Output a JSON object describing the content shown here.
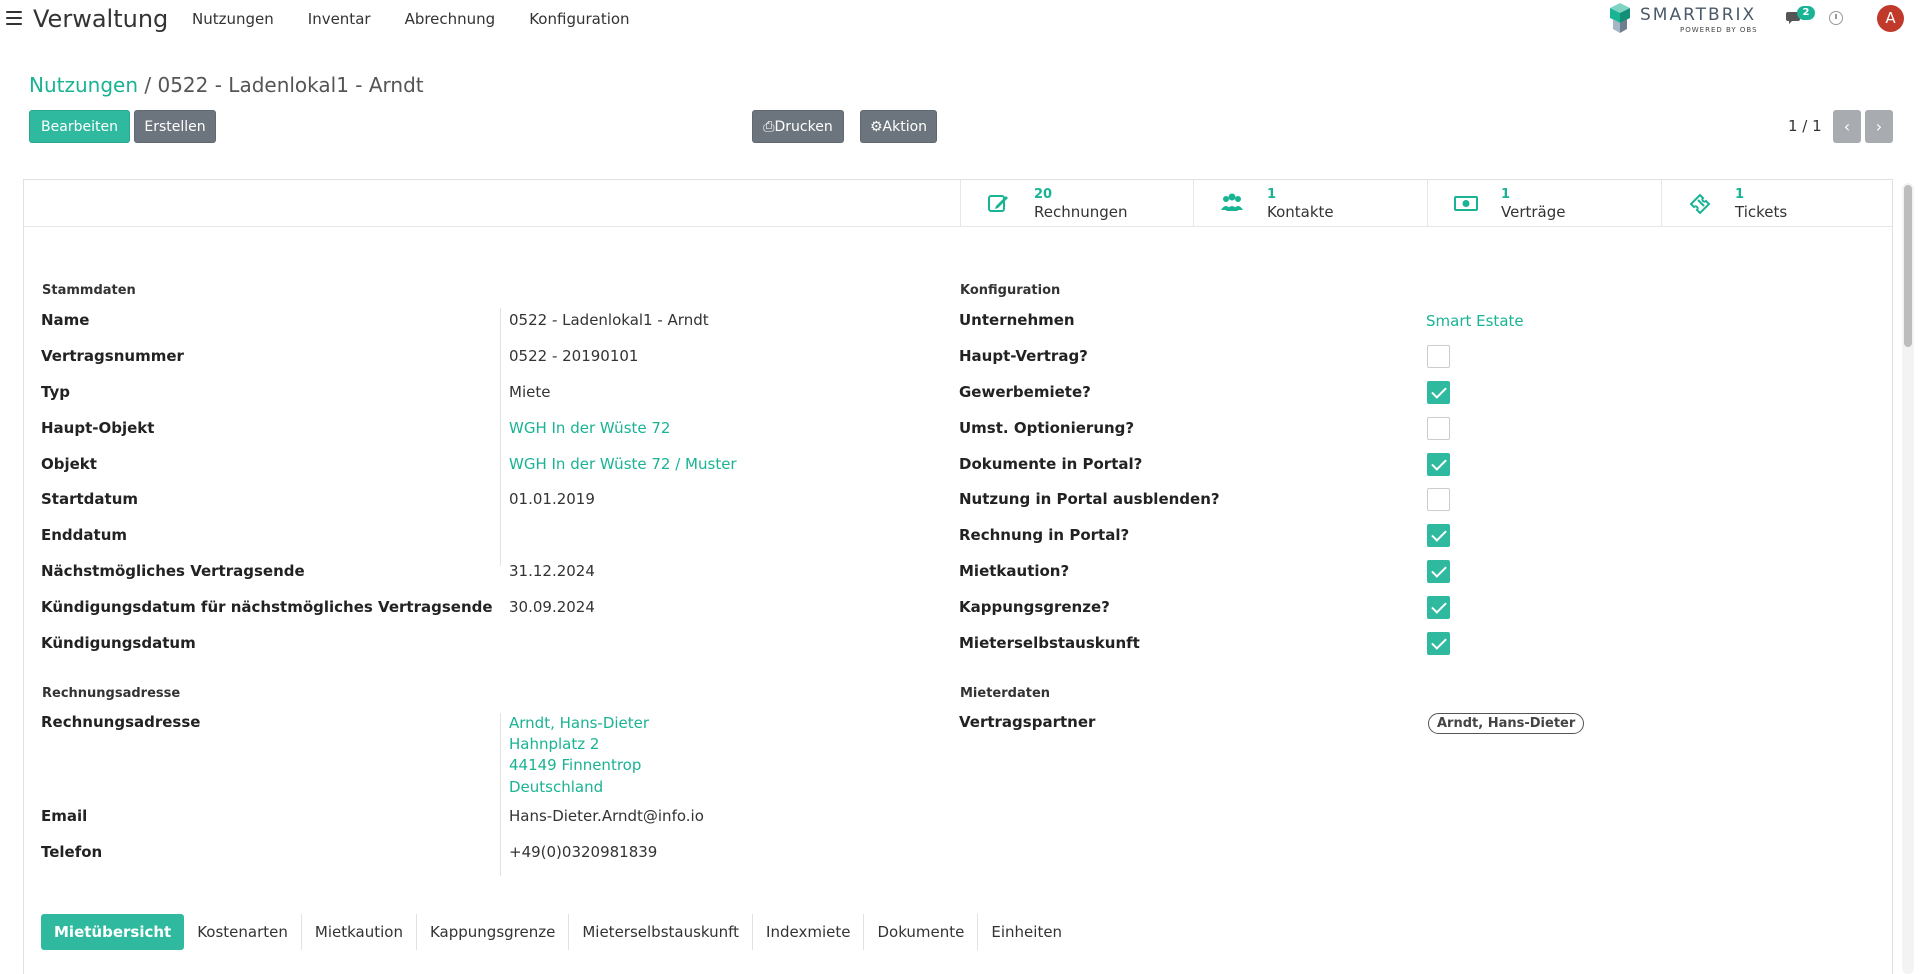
{
  "app": {
    "title": "Verwaltung"
  },
  "nav": {
    "items": [
      "Nutzungen",
      "Inventar",
      "Abrechnung",
      "Konfiguration"
    ]
  },
  "logo": {
    "text": "SMARTBRIX",
    "sub": "POWERED BY OBS"
  },
  "messages": {
    "count": "2"
  },
  "user": {
    "initial": "A"
  },
  "colors": {
    "accent": "#1ab394",
    "primary_button": "#2fbaa0",
    "secondary_button": "#6c757d",
    "avatar": "#c0392b"
  },
  "breadcrumb": {
    "parent": "Nutzungen",
    "separator": " / ",
    "current": "0522 - Ladenlokal1 - Arndt"
  },
  "toolbar": {
    "edit": "Bearbeiten",
    "create": "Erstellen",
    "print": "Drucken",
    "action": "Aktion"
  },
  "pager": {
    "value": "1 / 1"
  },
  "smart_buttons": [
    {
      "icon": "edit-icon",
      "value": "20",
      "label": "Rechnungen"
    },
    {
      "icon": "users-icon",
      "value": "1",
      "label": "Kontakte"
    },
    {
      "icon": "money-icon",
      "value": "1",
      "label": "Verträge"
    },
    {
      "icon": "ticket-icon",
      "value": "1",
      "label": "Tickets"
    }
  ],
  "stammdaten": {
    "title": "Stammdaten",
    "fields": [
      {
        "label": "Name",
        "value": "0522 - Ladenlokal1 - Arndt"
      },
      {
        "label": "Vertragsnummer",
        "value": "0522 - 20190101"
      },
      {
        "label": "Typ",
        "value": "Miete"
      },
      {
        "label": "Haupt-Objekt",
        "value": "WGH In der Wüste 72"
      },
      {
        "label": "Objekt",
        "value": "WGH In der Wüste 72 / Muster"
      },
      {
        "label": "Startdatum",
        "value": "01.01.2019"
      },
      {
        "label": "Enddatum",
        "value": ""
      },
      {
        "label": "Nächstmögliches Vertragsende",
        "value": "31.12.2024"
      },
      {
        "label": "Kündigungsdatum für nächstmögliches Vertragsende",
        "value": "30.09.2024"
      },
      {
        "label": "Kündigungsdatum",
        "value": ""
      }
    ]
  },
  "konfiguration": {
    "title": "Konfiguration",
    "company_label": "Unternehmen",
    "company_value": "Smart Estate",
    "flags": [
      {
        "label": "Haupt-Vertrag?",
        "checked": false
      },
      {
        "label": "Gewerbemiete?",
        "checked": true
      },
      {
        "label": "Umst. Optionierung?",
        "checked": false
      },
      {
        "label": "Dokumente in Portal?",
        "checked": true
      },
      {
        "label": "Nutzung in Portal ausblenden?",
        "checked": false
      },
      {
        "label": "Rechnung in Portal?",
        "checked": true
      },
      {
        "label": "Mietkaution?",
        "checked": true
      },
      {
        "label": "Kappungsgrenze?",
        "checked": true
      },
      {
        "label": "Mieterselbstauskunft",
        "checked": true
      }
    ]
  },
  "rechnungsadresse": {
    "title": "Rechnungsadresse",
    "address_label": "Rechnungsadresse",
    "address_lines": [
      "Arndt, Hans-Dieter",
      "Hahnplatz 2",
      "44149 Finnentrop",
      "Deutschland"
    ],
    "email_label": "Email",
    "email_value": "Hans-Dieter.Arndt@info.io",
    "phone_label": "Telefon",
    "phone_value": "+49(0)0320981839"
  },
  "mieterdaten": {
    "title": "Mieterdaten",
    "partner_label": "Vertragspartner",
    "partner_value": "Arndt, Hans-Dieter"
  },
  "tabs": [
    {
      "label": "Mietübersicht",
      "active": true
    },
    {
      "label": "Kostenarten",
      "active": false
    },
    {
      "label": "Mietkaution",
      "active": false
    },
    {
      "label": "Kappungsgrenze",
      "active": false
    },
    {
      "label": "Mieterselbstauskunft",
      "active": false
    },
    {
      "label": "Indexmiete",
      "active": false
    },
    {
      "label": "Dokumente",
      "active": false
    },
    {
      "label": "Einheiten",
      "active": false
    }
  ]
}
